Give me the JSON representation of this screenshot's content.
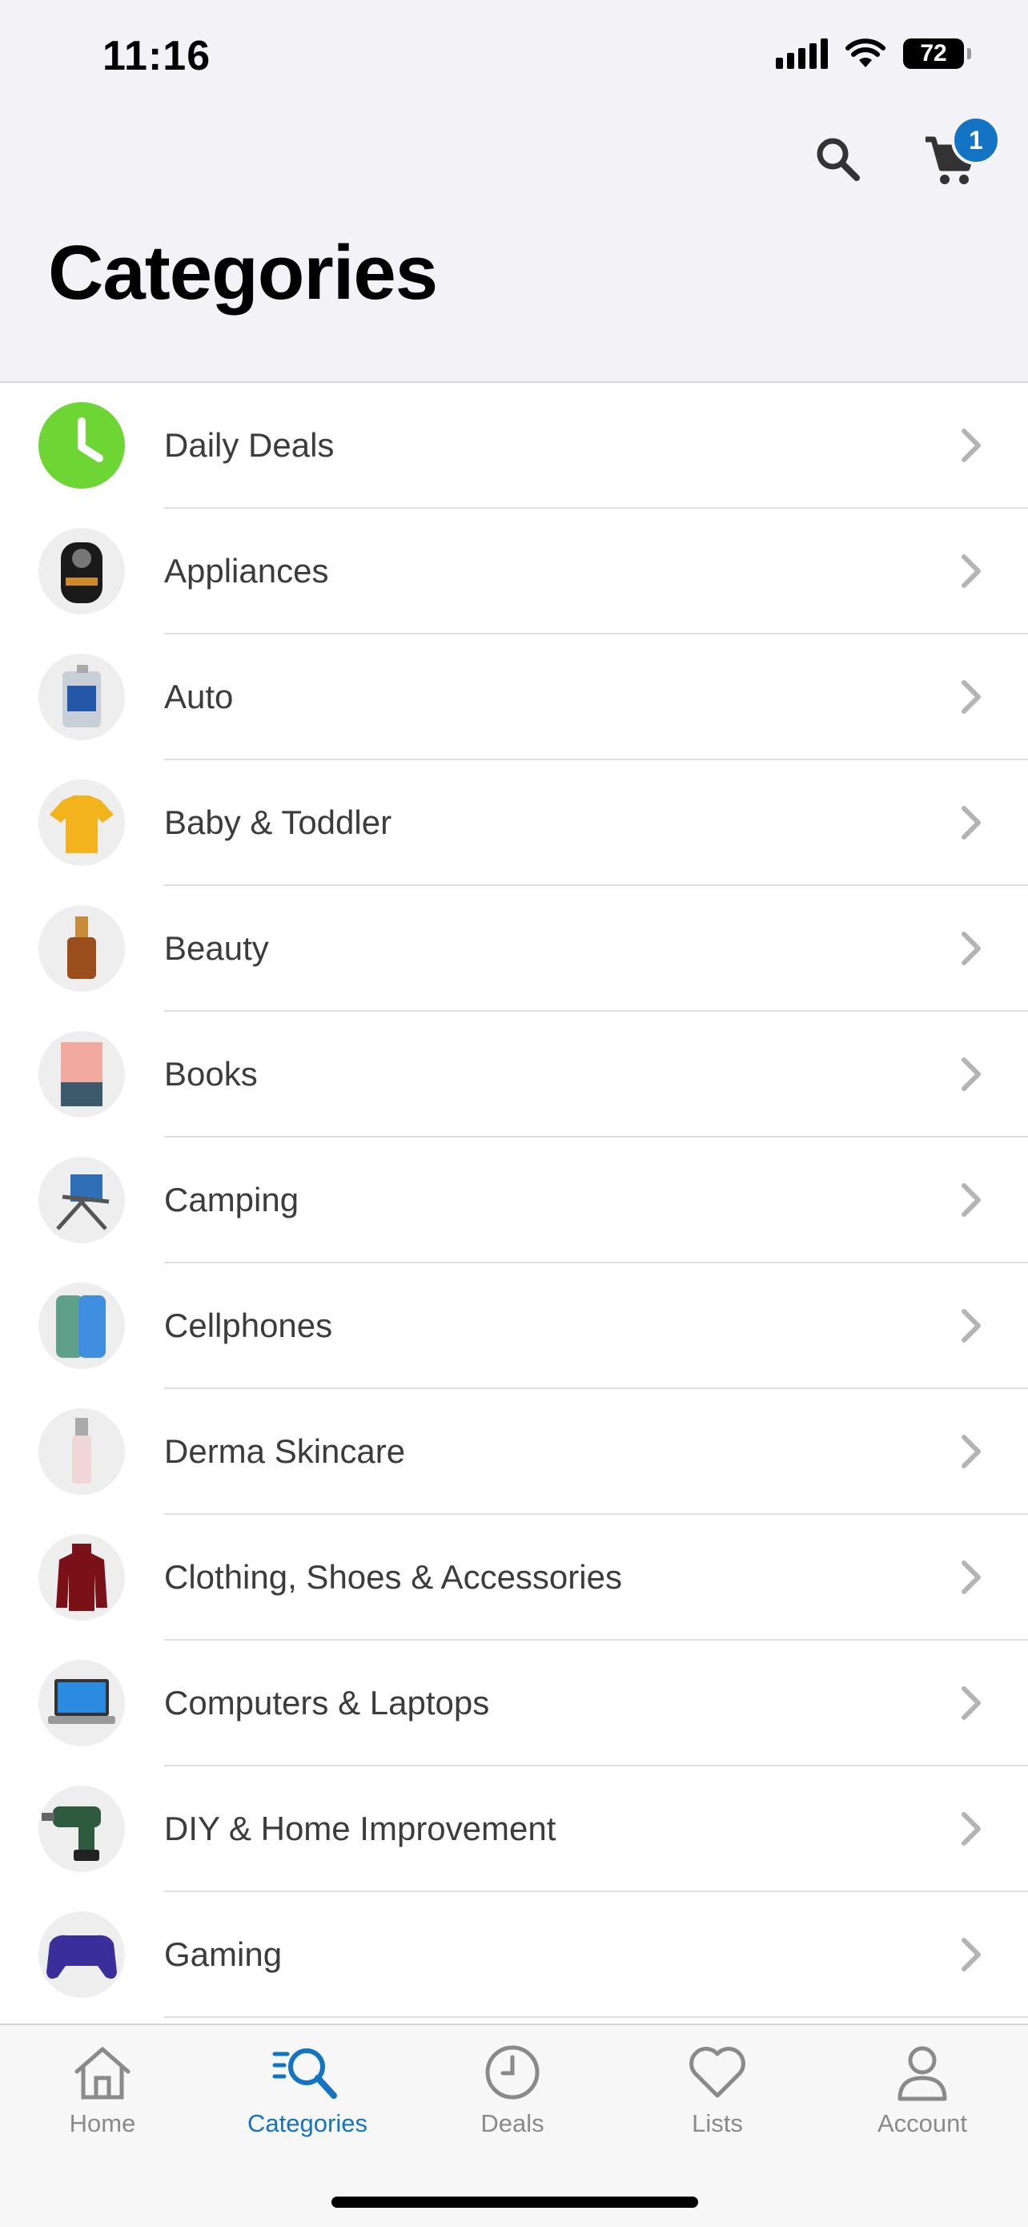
{
  "status_bar": {
    "time": "11:16",
    "battery": "72"
  },
  "header": {
    "title": "Categories",
    "cart_count": "1",
    "search_icon": "search-icon",
    "cart_icon": "cart-icon"
  },
  "categories": [
    {
      "label": "Daily Deals",
      "icon": "clock-icon"
    },
    {
      "label": "Appliances",
      "icon": "air-fryer-image"
    },
    {
      "label": "Auto",
      "icon": "motor-oil-image"
    },
    {
      "label": "Baby & Toddler",
      "icon": "baby-onesie-image"
    },
    {
      "label": "Beauty",
      "icon": "foundation-bottle-image"
    },
    {
      "label": "Books",
      "icon": "book-cover-image"
    },
    {
      "label": "Camping",
      "icon": "camping-chair-image"
    },
    {
      "label": "Cellphones",
      "icon": "smartphone-image"
    },
    {
      "label": "Derma Skincare",
      "icon": "serum-bottle-image"
    },
    {
      "label": "Clothing, Shoes & Accessories",
      "icon": "turtleneck-image"
    },
    {
      "label": "Computers & Laptops",
      "icon": "laptop-image"
    },
    {
      "label": "DIY & Home Improvement",
      "icon": "drill-image"
    },
    {
      "label": "Gaming",
      "icon": "controller-image"
    }
  ],
  "tabbar": {
    "home": "Home",
    "categories": "Categories",
    "deals": "Deals",
    "lists": "Lists",
    "account": "Account",
    "active": "categories"
  },
  "colors": {
    "accent": "#1474c4",
    "deals_green": "#6dd634",
    "header_bg": "#f2f2f7"
  }
}
